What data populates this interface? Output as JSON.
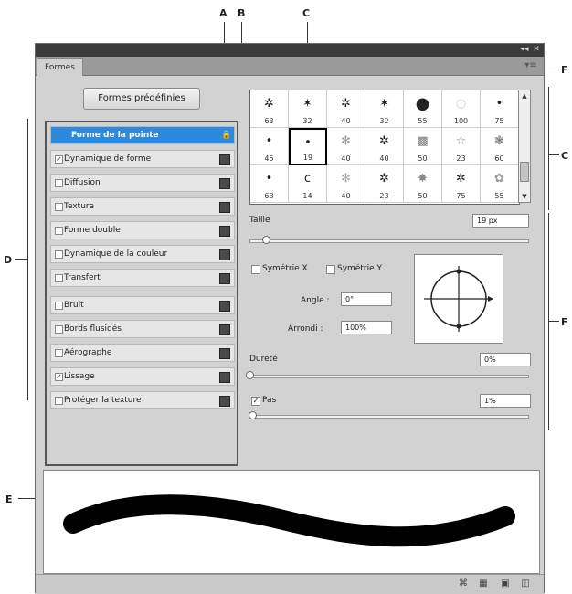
{
  "callouts": {
    "a": "A",
    "b": "B",
    "c_top": "C",
    "c_right": "C",
    "d": "D",
    "e": "E",
    "f": "F",
    "f_right": "F"
  },
  "panel": {
    "tab_label": "Formes",
    "menu_icon": "panel-menu-icon",
    "preset_button": "Formes prédéfinies"
  },
  "brush_settings": [
    {
      "label": "Forme de la pointe",
      "checked": false,
      "selected": true,
      "has_check": false
    },
    {
      "label": "Dynamique de forme",
      "checked": true,
      "selected": false,
      "has_check": true
    },
    {
      "label": "Diffusion",
      "checked": false,
      "selected": false,
      "has_check": true
    },
    {
      "label": "Texture",
      "checked": false,
      "selected": false,
      "has_check": true
    },
    {
      "label": "Forme double",
      "checked": false,
      "selected": false,
      "has_check": true
    },
    {
      "label": "Dynamique de la couleur",
      "checked": false,
      "selected": false,
      "has_check": true
    },
    {
      "label": "Transfert",
      "checked": false,
      "selected": false,
      "has_check": true
    },
    {
      "label": "Bruit",
      "checked": false,
      "selected": false,
      "has_check": true
    },
    {
      "label": "Bords flusidés",
      "checked": false,
      "selected": false,
      "has_check": true
    },
    {
      "label": "Aérographe",
      "checked": false,
      "selected": false,
      "has_check": true
    },
    {
      "label": "Lissage",
      "checked": true,
      "selected": false,
      "has_check": true
    },
    {
      "label": "Protéger la texture",
      "checked": false,
      "selected": false,
      "has_check": true
    }
  ],
  "brush_tips": [
    [
      "63",
      "32",
      "40",
      "32",
      "55",
      "100",
      "75"
    ],
    [
      "45",
      "19",
      "40",
      "40",
      "50",
      "23",
      "60"
    ],
    [
      "63",
      "14",
      "40",
      "23",
      "50",
      "75",
      "55"
    ]
  ],
  "selected_tip": "19",
  "controls": {
    "size_label": "Taille",
    "size_value": "19 px",
    "size_slider": 0.06,
    "flip_x_label": "Symétrie X",
    "flip_y_label": "Symétrie Y",
    "angle_label": "Angle :",
    "angle_value": "0°",
    "roundness_label": "Arrondi :",
    "roundness_value": "100%",
    "hardness_label": "Dureté",
    "hardness_value": "0%",
    "hardness_slider": 0.0,
    "spacing_label": "Pas",
    "spacing_checked": true,
    "spacing_value": "1%",
    "spacing_slider": 0.01
  }
}
